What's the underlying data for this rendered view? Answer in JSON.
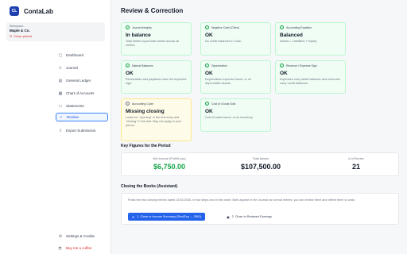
{
  "brand": {
    "logo_text": "CL",
    "name": "ContaLab"
  },
  "workspace": {
    "label": "Workspace",
    "name": "Maple & Co.",
    "close_period": "Close period"
  },
  "nav": [
    {
      "label": "Dashboard",
      "icon": "dashboard-icon",
      "glyph": "▢"
    },
    {
      "label": "Journal",
      "icon": "journal-icon",
      "glyph": "≡"
    },
    {
      "label": "General Ledger",
      "icon": "ledger-icon",
      "glyph": "▤"
    },
    {
      "label": "Chart of Accounts",
      "icon": "accounts-icon",
      "glyph": "▦"
    },
    {
      "label": "Statements",
      "icon": "statements-icon",
      "glyph": "▭"
    },
    {
      "label": "Review",
      "icon": "review-icon",
      "glyph": "✓"
    },
    {
      "label": "Export Submission",
      "icon": "export-icon",
      "glyph": "⇩"
    }
  ],
  "footer_nav": {
    "settings": "Settings & Credits",
    "coffee": "Buy me a coffee"
  },
  "page": {
    "title": "Review & Correction"
  },
  "checks": [
    {
      "title": "Journal Integrity",
      "status": "In balance",
      "desc": "Total debits equal total credits across all entries."
    },
    {
      "title": "Negative Cash (Cflow)",
      "status": "OK",
      "desc": "No credit balances in Cash."
    },
    {
      "title": "Accounting Equation",
      "status": "Balanced",
      "desc": "Assets = Liabilities + Equity."
    },
    {
      "title": "Natural Balances",
      "status": "OK",
      "desc": "Receivables and payables have the expected sign."
    },
    {
      "title": "Depreciation",
      "status": "OK",
      "desc": "Depreciation expense found, or no depreciable assets."
    },
    {
      "title": "Revenue / Expense Sign",
      "status": "OK",
      "desc": "Expenses carry debit balances and revenues carry credit balances."
    },
    {
      "title": "Accounting Cycle",
      "status": "Missing closing",
      "desc": "Looks for \"opening\" in the first entry and \"closing\" in the last. May not apply to your period."
    },
    {
      "title": "Cost of Goods Sold",
      "status": "OK",
      "desc": "Cost of sales found, or no inventory."
    }
  ],
  "key_figures": {
    "title": "Key Figures for the Period",
    "items": [
      {
        "label": "Net Income (Profit/Loss)",
        "value": "$6,750.00"
      },
      {
        "label": "Total Assets",
        "value": "$107,500.00"
      },
      {
        "label": "# of Entries",
        "value": "21"
      }
    ]
  },
  "closing": {
    "title": "Closing the Books (Assistant)",
    "desc": "Posts the real closing entries dated 12/31/2026, in two steps and in this order. Both appear in the Journal as normal entries: you can review them and delete them to undo.",
    "step1": "1. Close to Income Summary (Rev/Exp → 3901)",
    "step2": "2. Close to Retained Earnings"
  },
  "colors": {
    "accent": "#2563eb",
    "ok_bg": "#f0fdf4",
    "warn_bg": "#fefce8",
    "positive": "#16a34a",
    "danger": "#dc2626"
  }
}
